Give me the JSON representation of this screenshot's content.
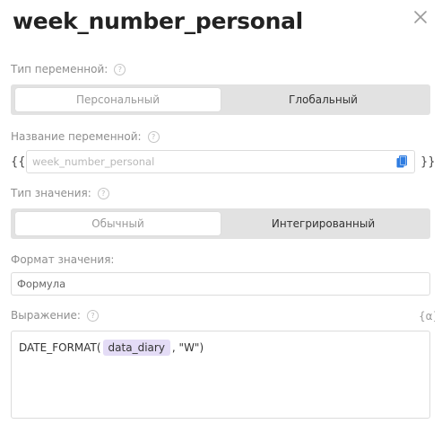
{
  "dialog": {
    "title": "week_number_personal"
  },
  "variable_type": {
    "label": "Тип переменной:",
    "options": [
      "Персональный",
      "Глобальный"
    ],
    "selected": "Персональный"
  },
  "variable_name": {
    "label": "Название переменной:",
    "open_brace": "{{",
    "close_brace": "}}",
    "value": "",
    "placeholder": "week_number_personal"
  },
  "value_type": {
    "label": "Тип значения:",
    "options": [
      "Обычный",
      "Интегрированный"
    ],
    "selected": "Обычный"
  },
  "value_format": {
    "label": "Формат значения:",
    "value": "Формула"
  },
  "expression": {
    "label": "Выражение:",
    "formula_icon_text": "{α}",
    "prefix": "DATE_FORMAT(",
    "variable": "data_diary",
    "suffix": ", \"W\")"
  },
  "icons": {
    "close": "close-icon",
    "help": "help-icon",
    "copy": "copy-icon",
    "formula": "formula-icon"
  },
  "colors": {
    "accent": "#2f7de1",
    "chip": "#e4dcf6",
    "segment_bg": "#e2e2e2"
  }
}
